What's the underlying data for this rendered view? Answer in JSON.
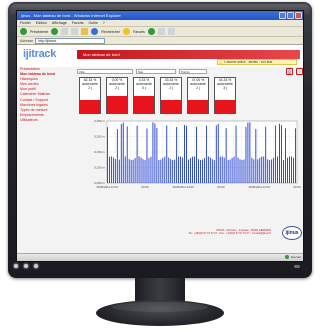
{
  "browser": {
    "title": "ijinus - Mon tableau de bord - Windows Internet Explorer",
    "menu": [
      "Fichier",
      "Edition",
      "Affichage",
      "Favoris",
      "Outils",
      "?"
    ],
    "toolbar": {
      "back_label": "Précédente",
      "search_label": "Rechercher",
      "favorites_label": "Favoris"
    },
    "address_label": "Adresse",
    "address_value": "http://ijitrack"
  },
  "app": {
    "logo": "ijitrack",
    "header_title": "Mon tableau de bord",
    "alert_text": "1 alarme active - alertes : voir liste"
  },
  "sidebar": {
    "items": [
      {
        "label": "Présentation",
        "active": false
      },
      {
        "label": "Mon tableau de bord",
        "active": true
      },
      {
        "label": "Historiques",
        "active": false
      },
      {
        "label": "Mes alertes",
        "active": false
      },
      {
        "label": "Mon profil",
        "active": false
      },
      {
        "label": "Calendrier Maitrise",
        "active": false
      },
      {
        "label": "Contact / Support",
        "active": false
      },
      {
        "label": "Machines légales",
        "active": false
      },
      {
        "label": "Types de mesure",
        "active": false
      },
      {
        "label": "Emplacements",
        "active": false
      },
      {
        "label": "Utilisateurs",
        "active": false
      }
    ]
  },
  "filters": {
    "field1": "Ville",
    "field2": "Site",
    "field3": "Points"
  },
  "cards": [
    {
      "percent": "82.33 %",
      "label": "autonomie",
      "duration": "2 j",
      "fill": 0.38
    },
    {
      "percent": "0.00 %",
      "label": "autonomie",
      "duration": "2 j",
      "fill": 0.5
    },
    {
      "percent": "0.33 %",
      "label": "autonomie",
      "duration": "0 j",
      "fill": 0.5
    },
    {
      "percent": "43.33 %",
      "label": "autonomie",
      "duration": "2 j",
      "fill": 0.38
    },
    {
      "percent": "47.00 %",
      "label": "autonomie",
      "duration": "2 j",
      "fill": 0.38
    },
    {
      "percent": "44.33 %",
      "label": "autonomie",
      "duration": "3 j",
      "fill": 0.38
    }
  ],
  "chart_data": {
    "type": "line",
    "title": "",
    "ylabel": "",
    "xlabel": "",
    "y_ticks": [
      "0,250 m",
      "0,200 m",
      "0,150 m",
      "0,100 m",
      "0,050 m"
    ],
    "x_ticks": [
      "10/06/2011 12:00",
      "00:00",
      "10/06/2011 12:00",
      "00:00",
      "10/06/2011 12:00",
      "00:00"
    ],
    "series": [
      {
        "name": "",
        "color": "#0022cc",
        "values": [
          0.05,
          0.05,
          0.25,
          0.05,
          0.05,
          0.24,
          0.05,
          0.05,
          0.25,
          0.05,
          0.05,
          0.05
        ]
      }
    ],
    "grid": true
  },
  "footer": {
    "line1": "IJINUS - ZA Kerio - Impasse - 56000 GERMAIN",
    "line2": "Tel : +33(0)2 97 07 07 07 - Fax : +33(0)2 97 07 07 07 - contact@ijinus.fr",
    "brand": "ijinus"
  },
  "taskbar": {
    "status": "Internet"
  }
}
